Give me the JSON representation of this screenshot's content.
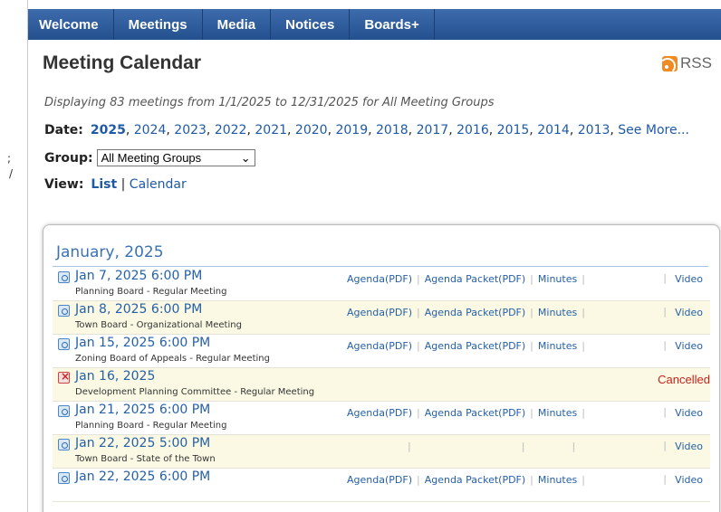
{
  "nav": {
    "items": [
      "Welcome",
      "Meetings",
      "Media",
      "Notices",
      "Boards+"
    ]
  },
  "edge_text": {
    "a": ";",
    "b": "/"
  },
  "page": {
    "title": "Meeting Calendar",
    "rss_label": "RSS"
  },
  "summary": "Displaying 83 meetings from 1/1/2025 to 12/31/2025 for All Meeting Groups",
  "filters": {
    "date_label": "Date:",
    "years": [
      "2025",
      "2024",
      "2023",
      "2022",
      "2021",
      "2020",
      "2019",
      "2018",
      "2017",
      "2016",
      "2015",
      "2014",
      "2013"
    ],
    "see_more": "See More...",
    "group_label": "Group:",
    "group_selected": "All Meeting Groups",
    "view_label": "View:",
    "view_list": "List",
    "view_calendar": "Calendar"
  },
  "month": "January, 2025",
  "meetings": [
    {
      "when": "Jan 7, 2025 6:00 PM",
      "desc": "Planning Board - Regular Meeting",
      "agenda": "Agenda(PDF)",
      "packet": "Agenda Packet(PDF)",
      "minutes": "Minutes",
      "video": "Video",
      "status": ""
    },
    {
      "when": "Jan 8, 2025 6:00 PM",
      "desc": "Town Board - Organizational Meeting",
      "agenda": "Agenda(PDF)",
      "packet": "Agenda Packet(PDF)",
      "minutes": "Minutes",
      "video": "Video",
      "status": ""
    },
    {
      "when": "Jan 15, 2025 6:00 PM",
      "desc": "Zoning Board of Appeals - Regular Meeting",
      "agenda": "Agenda(PDF)",
      "packet": "Agenda Packet(PDF)",
      "minutes": "Minutes",
      "video": "Video",
      "status": ""
    },
    {
      "when": "Jan 16, 2025",
      "desc": "Development Planning Committee - Regular Meeting",
      "agenda": "",
      "packet": "",
      "minutes": "",
      "video": "",
      "status": "Cancelled"
    },
    {
      "when": "Jan 21, 2025 6:00 PM",
      "desc": "Planning Board - Regular Meeting",
      "agenda": "Agenda(PDF)",
      "packet": "Agenda Packet(PDF)",
      "minutes": "Minutes",
      "video": "Video",
      "status": ""
    },
    {
      "when": "Jan 22, 2025 5:00 PM",
      "desc": "Town Board - State of the Town",
      "agenda": "",
      "packet": "",
      "minutes": "",
      "video": "Video",
      "status": ""
    },
    {
      "when": "Jan 22, 2025 6:00 PM",
      "desc": "",
      "agenda": "Agenda(PDF)",
      "packet": "Agenda Packet(PDF)",
      "minutes": "Minutes",
      "video": "Video",
      "status": ""
    }
  ]
}
